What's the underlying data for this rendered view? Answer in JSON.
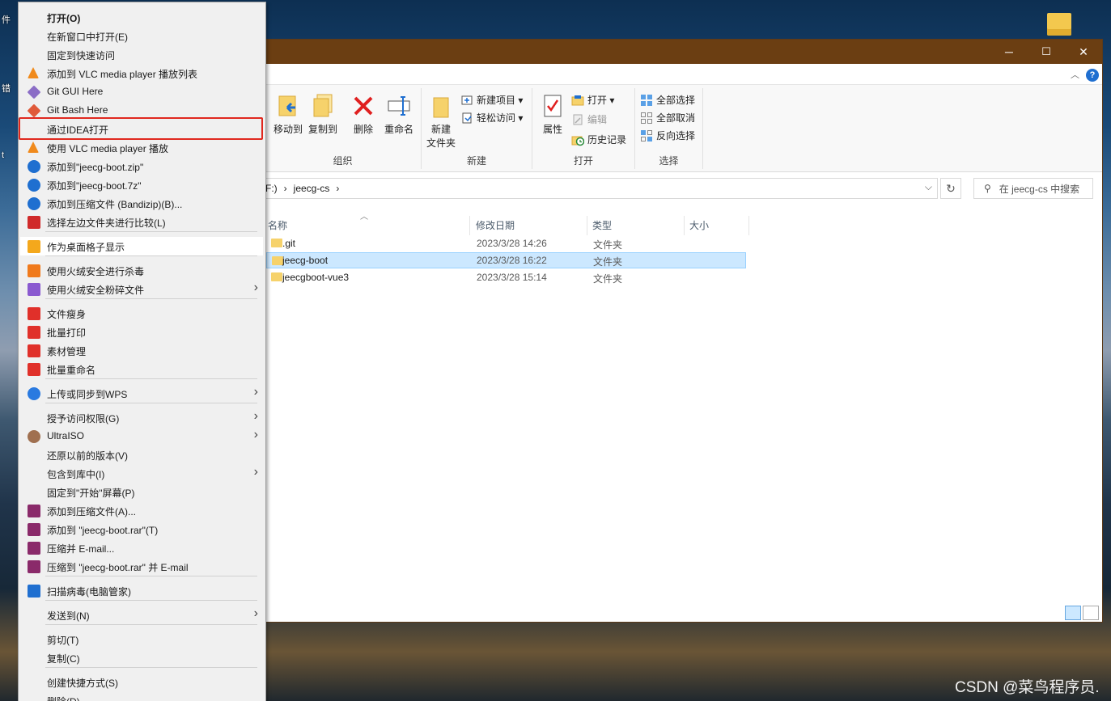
{
  "desktop": {
    "edge_labels": [
      "件",
      "错",
      "t"
    ]
  },
  "explorer": {
    "window_buttons": {
      "minimize": "─",
      "maximize": "☐",
      "close": "✕"
    },
    "help": "?",
    "ribbon": {
      "organize": {
        "label": "组织",
        "move_to": "移动到",
        "copy_to": "复制到",
        "delete": "删除",
        "rename": "重命名"
      },
      "new": {
        "label": "新建",
        "new_folder_line1": "新建",
        "new_folder_line2": "文件夹",
        "new_item": "新建项目 ▾",
        "easy_access": "轻松访问 ▾"
      },
      "open": {
        "label": "打开",
        "properties": "属性",
        "open": "打开 ▾",
        "edit": "编辑",
        "history": "历史记录"
      },
      "select": {
        "label": "选择",
        "select_all": "全部选择",
        "select_none": "全部取消",
        "invert": "反向选择"
      }
    },
    "address": {
      "drive": "F:)",
      "sep": "›",
      "folder": "jeecg-cs",
      "sep2": "›"
    },
    "search_placeholder": "在 jeecg-cs 中搜索",
    "columns": {
      "name": "名称",
      "modified": "修改日期",
      "type": "类型",
      "size": "大小"
    },
    "files": [
      {
        "name": ".git",
        "date": "2023/3/28 14:26",
        "type": "文件夹"
      },
      {
        "name": "jeecg-boot",
        "date": "2023/3/28 16:22",
        "type": "文件夹"
      },
      {
        "name": "jeecgboot-vue3",
        "date": "2023/3/28 15:14",
        "type": "文件夹"
      }
    ]
  },
  "context_menu": {
    "items": [
      {
        "label": "打开(O)"
      },
      {
        "label": "在新窗口中打开(E)"
      },
      {
        "label": "固定到快速访问"
      },
      {
        "label": "添加到 VLC media player 播放列表"
      },
      {
        "label": "Git GUI Here"
      },
      {
        "label": "Git Bash Here"
      },
      {
        "label": "通过IDEA打开"
      },
      {
        "label": "使用 VLC media player 播放"
      },
      {
        "label": "添加到\"jeecg-boot.zip\""
      },
      {
        "label": "添加到\"jeecg-boot.7z\""
      },
      {
        "label": "添加到压缩文件 (Bandizip)(B)..."
      },
      {
        "label": "选择左边文件夹进行比较(L)"
      },
      {
        "label": "作为桌面格子显示"
      },
      {
        "label": "使用火绒安全进行杀毒"
      },
      {
        "label": "使用火绒安全粉碎文件"
      },
      {
        "label": "文件瘦身"
      },
      {
        "label": "批量打印"
      },
      {
        "label": "素材管理"
      },
      {
        "label": "批量重命名"
      },
      {
        "label": "上传或同步到WPS"
      },
      {
        "label": "授予访问权限(G)"
      },
      {
        "label": "UltraISO"
      },
      {
        "label": "还原以前的版本(V)"
      },
      {
        "label": "包含到库中(I)"
      },
      {
        "label": "固定到\"开始\"屏幕(P)"
      },
      {
        "label": "添加到压缩文件(A)..."
      },
      {
        "label": "添加到 \"jeecg-boot.rar\"(T)"
      },
      {
        "label": "压缩并 E-mail..."
      },
      {
        "label": "压缩到 \"jeecg-boot.rar\" 并 E-mail"
      },
      {
        "label": "扫描病毒(电脑管家)"
      },
      {
        "label": "发送到(N)"
      },
      {
        "label": "剪切(T)"
      },
      {
        "label": "复制(C)"
      },
      {
        "label": "创建快捷方式(S)"
      },
      {
        "label": "删除(D)"
      }
    ],
    "arrow": "›"
  },
  "watermark": "CSDN @菜鸟程序员."
}
